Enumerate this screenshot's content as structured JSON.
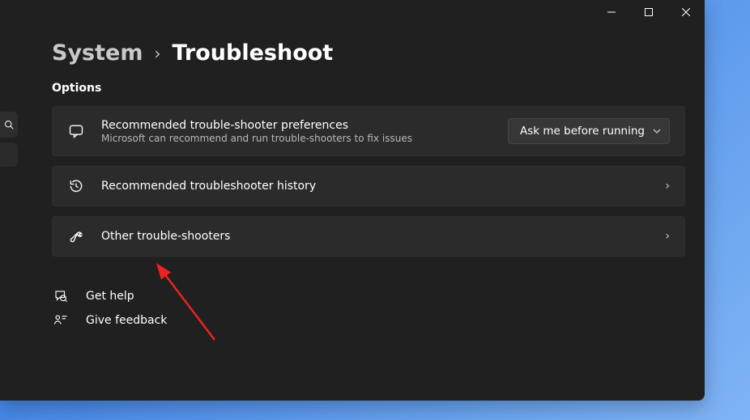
{
  "breadcrumb": {
    "parent": "System",
    "current": "Troubleshoot"
  },
  "section_label": "Options",
  "options": {
    "preferences": {
      "title": "Recommended trouble-shooter preferences",
      "subtitle": "Microsoft can recommend and run trouble-shooters to fix issues",
      "dropdown_value": "Ask me before running"
    },
    "history": {
      "title": "Recommended troubleshooter history"
    },
    "other": {
      "title": "Other trouble-shooters"
    }
  },
  "footer": {
    "get_help": "Get help",
    "give_feedback": "Give feedback"
  }
}
